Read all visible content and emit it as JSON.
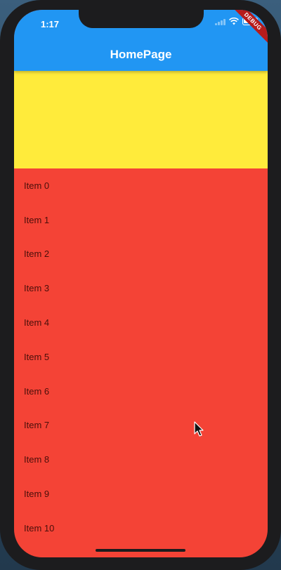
{
  "status_bar": {
    "time": "1:17",
    "icons": [
      "signal-icon",
      "wifi-icon",
      "battery-icon"
    ]
  },
  "app_bar": {
    "title": "HomePage",
    "color": "#2196f3"
  },
  "debug_banner": {
    "label": "DEBUG",
    "color": "#b71c1c"
  },
  "header": {
    "color": "#ffeb3b"
  },
  "list": {
    "background": "#f44336",
    "items": [
      "Item 0",
      "Item 1",
      "Item 2",
      "Item 3",
      "Item 4",
      "Item 5",
      "Item 6",
      "Item 7",
      "Item 8",
      "Item 9",
      "Item 10"
    ]
  }
}
